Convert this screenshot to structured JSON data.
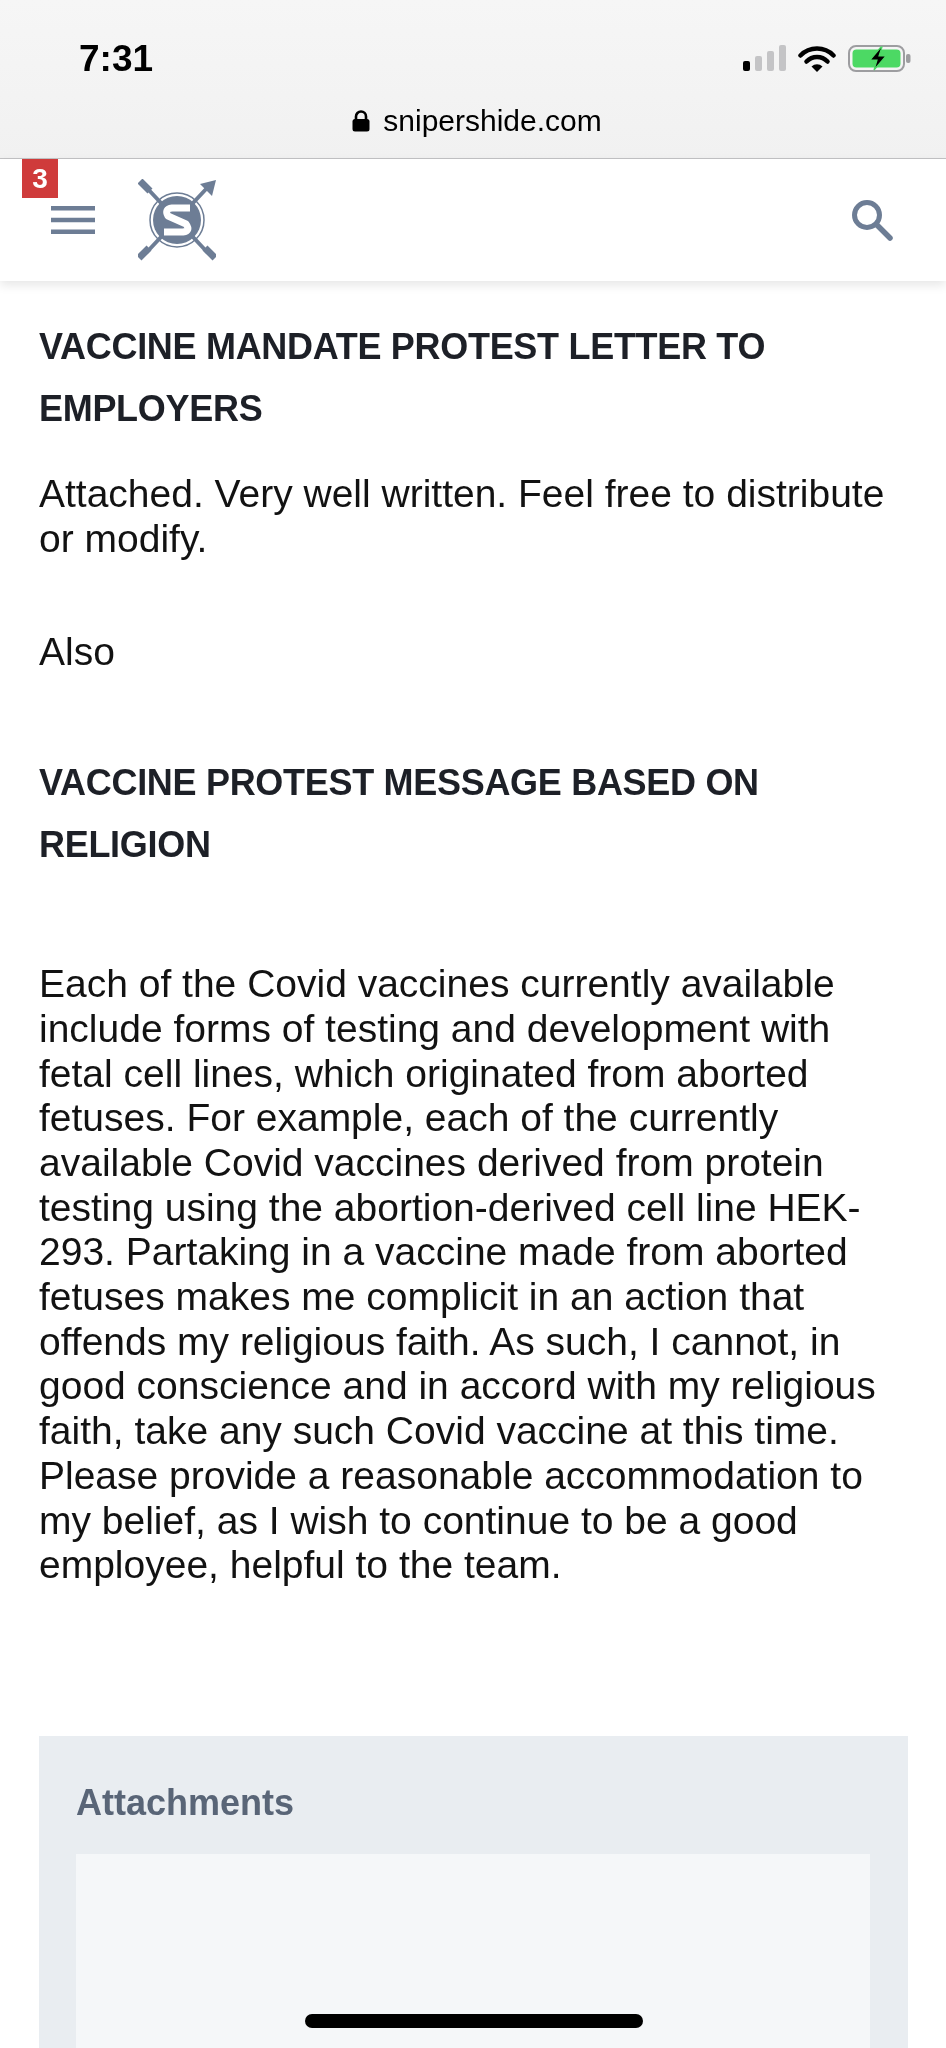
{
  "status_bar": {
    "time": "7:31"
  },
  "address_bar": {
    "url": "snipershide.com"
  },
  "site_header": {
    "notification_count": "3"
  },
  "post": {
    "blocks": [
      {
        "kind": "heading",
        "text": "VACCINE MANDATE PROTEST LETTER TO EMPLOYERS"
      },
      {
        "kind": "paragraph",
        "text": "Attached. Very well written. Feel free to distribute or modify."
      },
      {
        "kind": "paragraph",
        "text": "Also"
      },
      {
        "kind": "heading",
        "text": "VACCINE PROTEST MESSAGE BASED ON RELIGION"
      },
      {
        "kind": "paragraph",
        "text": "Each of the Covid vaccines currently available include forms of testing and development with fetal cell lines, which originated from aborted fetuses. For example, each of the currently available Covid vaccines derived from protein testing using the abortion-derived cell line HEK-293. Partaking in a vaccine made from aborted fetuses makes me complicit in an action that offends my religious faith. As such, I cannot, in good conscience and in accord with my religious faith, take any such Covid vaccine at this time. Please provide a reasonable accommodation to my belief, as I wish to continue to be a good employee, helpful to the team."
      }
    ]
  },
  "attachments": {
    "title": "Attachments"
  }
}
